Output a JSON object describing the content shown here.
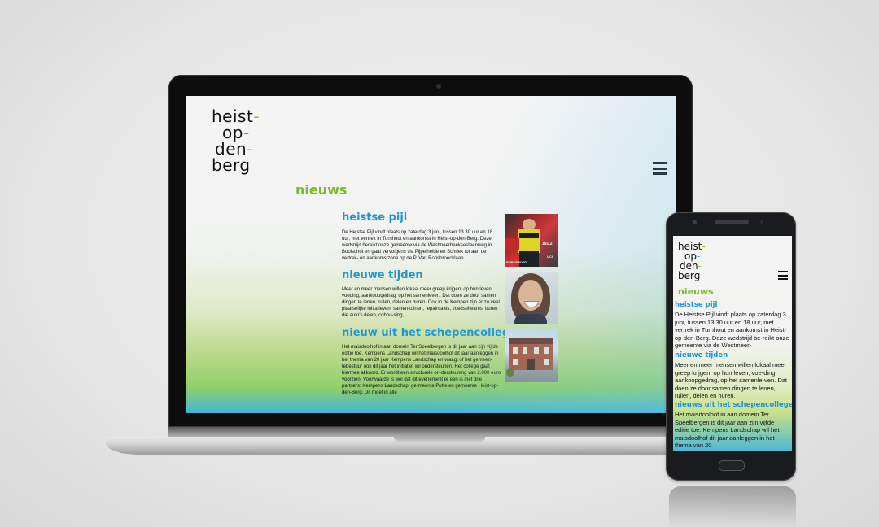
{
  "brand": {
    "logo_lines": [
      "heist",
      "op",
      "den",
      "berg"
    ],
    "logo_dashes": [
      "-",
      "-",
      "-"
    ]
  },
  "colors": {
    "accent_green": "#7cb82f",
    "accent_blue": "#1e95d4",
    "logo_green_dash": "#8dc63f",
    "logo_blue_dash": "#2da6dc"
  },
  "nav": {
    "menu_icon": "hamburger-menu-icon"
  },
  "section": {
    "title": "nieuws"
  },
  "desktop_articles": [
    {
      "title": "heistse pijl",
      "body": "De Heistse Pijl vindt plaats op zaterdag 3 juni, tussen 13.30 uur en 18 uur, met vertrek in Turnhout en aankomst in Heist-op-den-Berg. Deze wedstrijd bereikt onze gemeente via de Westmeerbeeksesteenweg in Booischot en gaat vervolgens via Pijpelheide en Schriek tot aan de vertrek- en aankomstzone op de P. Van Roosbroecklaan.",
      "image_labels": [
        "191.2",
        "EUROSPORT",
        "UCI"
      ]
    },
    {
      "title": "nieuwe tijden",
      "body": "Meer en meer mensen willen lokaal meer greep krijgen: op hun leven, voeding, aankoopgedrag, op het samenleven. Dat doen ze door samen dingen te lenen, ruilen, delen en huren. Ook in de Kempen zijn er zo veel plaatselijke initiatieven: samen-tuinen, repaircafés, voedselteams, buren die auto's delen, cohou-sing, ..."
    },
    {
      "title": "nieuw uit het schepencollege",
      "body": "Het maisdoolhof in aan domein Ter Speelbergen is dit jaar aan zijn vijfde editie toe. Kempens Landschap wil het maisdoolhof dit jaar aanleggen in het thema van 20 jaar Kempens Landschap en vraagt of het gemeen-tebestuur ook dit jaar het initiatief wil ondersteunen. Het college gaat hiermee akkoord. Er wordt een structurele on-dersteuning van 2.000 euro voorzien. Voorwaarde is wel dat dit evenement er een is met drie partners: Kempens Landschap, ge-meente Putte en gemeente Heist-op-den-Berg. Dit moet in alle"
    }
  ],
  "mobile_articles": [
    {
      "title": "heistse pijl",
      "body": "De Heistse Pijl vindt plaats op zaterdag 3 juni, tussen 13.30 uur en 18 uur, met vertrek in Turnhout en aankomst in Heist-op-den-Berg. Deze wedstrijd be-reikt onze gemeente via de Westmeer-"
    },
    {
      "title": "nieuwe tijden",
      "body": "Meer en meer mensen willen lokaal meer greep krijgen: op hun leven, voe-ding, aankoopgedrag, op het samenle-ven. Dat doen ze door samen dingen te lenen, ruilen, delen en huren."
    },
    {
      "title": "nieuws uit het schepencollege",
      "body": "Het maisdoolhof in aan domein Ter Speelbergen is dit jaar aan zijn vijfde editie toe. Kempens Landschap wil het maisdoolhof dit jaar aanleggen in het thema van 20"
    }
  ]
}
